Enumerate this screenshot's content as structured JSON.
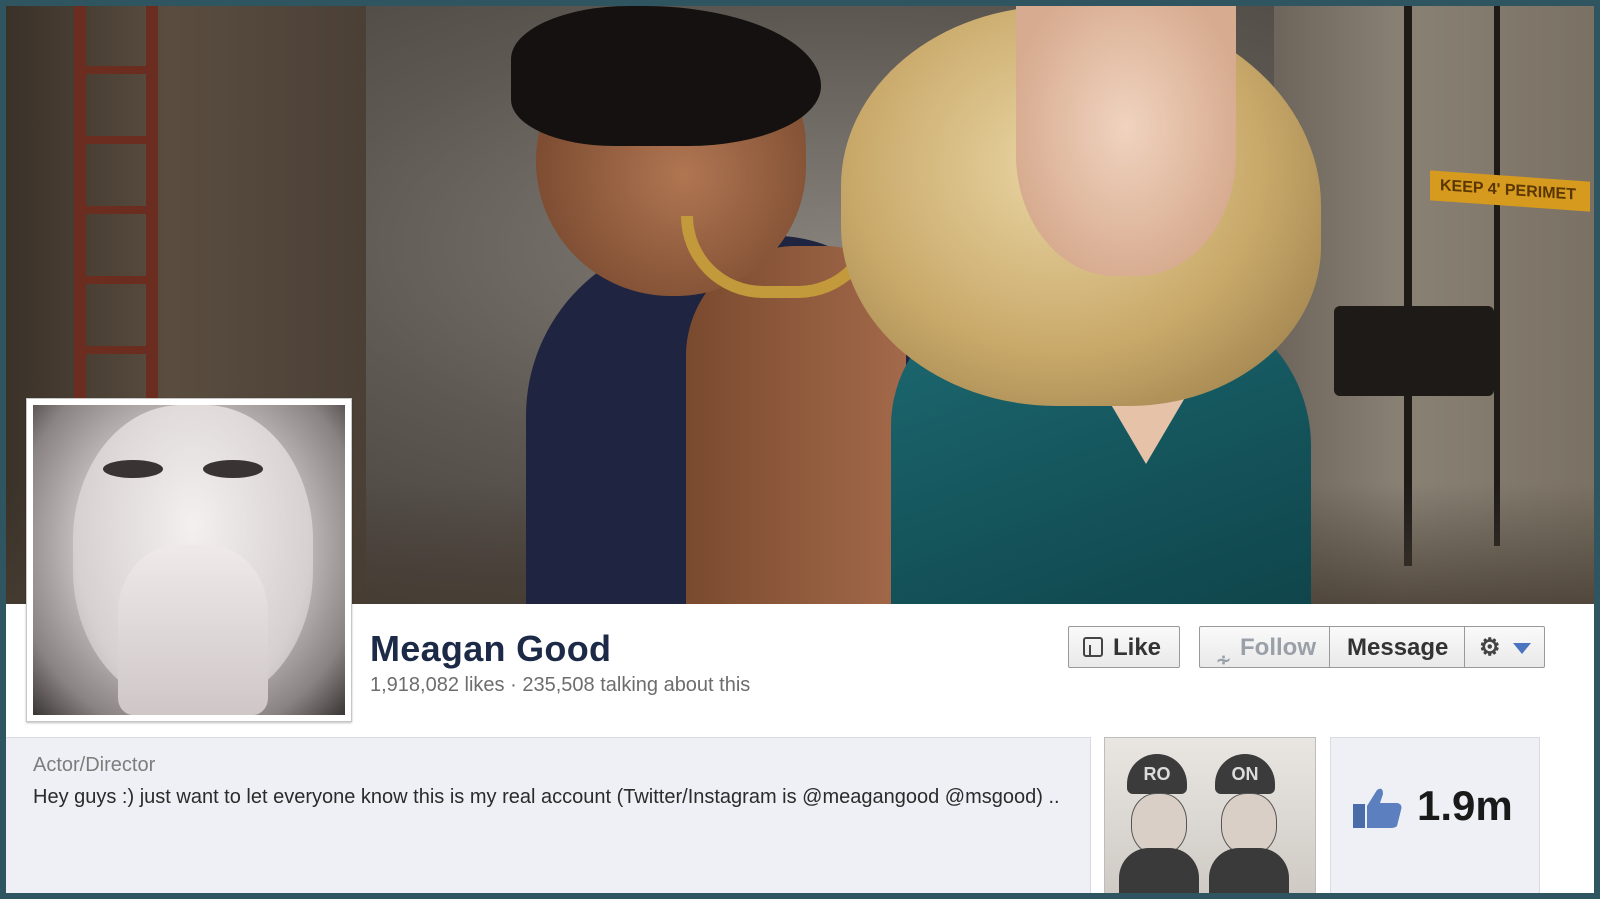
{
  "page": {
    "name": "Meagan Good",
    "likes": "1,918,082 likes",
    "separator": "·",
    "talking": "235,508 talking about this"
  },
  "actions": {
    "like": "Like",
    "follow": "Follow",
    "message": "Message"
  },
  "cover": {
    "sign_text": "KEEP 4' PERIMET"
  },
  "about": {
    "category": "Actor/Director",
    "text": "Hey guys :) just want to let everyone know this is my real account (Twitter/Instagram is @meagangood @msgood) .."
  },
  "thumbnail": {
    "cap_left": "RO",
    "cap_right": "ON"
  },
  "likes_box": {
    "count": "1.9m"
  },
  "colors": {
    "border": "#2e5560",
    "name": "#1c2a47",
    "accent": "#4a74c0",
    "panel": "#eef0f5"
  }
}
